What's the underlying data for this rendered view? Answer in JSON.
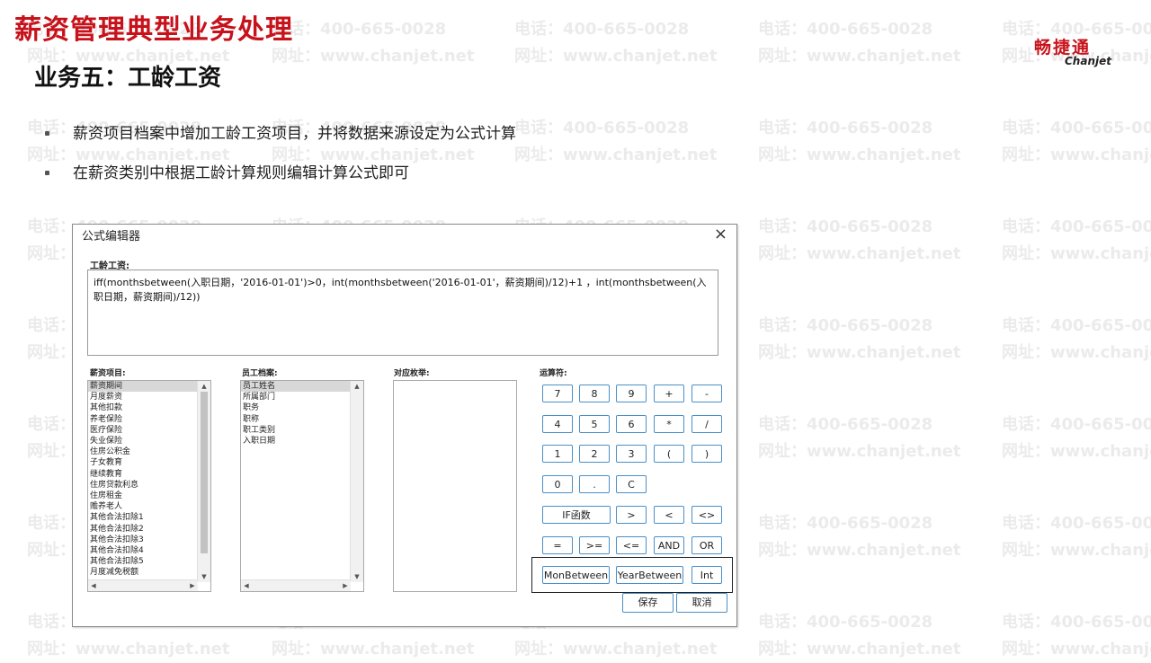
{
  "watermark": {
    "phone": "电话：400-665-0028",
    "site": "网址：www.chanjet.net"
  },
  "header": {
    "title": "薪资管理典型业务处理",
    "subtitle": "业务五：工龄工资"
  },
  "logo": {
    "cn": "畅捷通",
    "en": "Chanjet"
  },
  "bullets": [
    "薪资项目档案中增加工龄工资项目，并将数据来源设定为公式计算",
    "在薪资类别中根据工龄计算规则编辑计算公式即可"
  ],
  "dialog": {
    "title": "公式编辑器",
    "close_icon": "×",
    "formula_label": "工龄工资:",
    "formula_text": "iff(monthsbetween(入职日期，'2016-01-01')>0，int(monthsbetween('2016-01-01'，薪资期间)/12)+1 ，int(monthsbetween(入职日期，薪资期间)/12))",
    "salary_items": {
      "label": "薪资项目:",
      "items": [
        "薪资期间",
        "月度薪资",
        "其他扣款",
        "养老保险",
        "医疗保险",
        "失业保险",
        "住房公积金",
        "子女教育",
        "继续教育",
        "住房贷款利息",
        "住房租金",
        "赡养老人",
        "其他合法扣除1",
        "其他合法扣除2",
        "其他合法扣除3",
        "其他合法扣除4",
        "其他合法扣除5",
        "月度减免税额"
      ]
    },
    "employee_files": {
      "label": "员工档案:",
      "items": [
        "员工姓名",
        "所属部门",
        "职务",
        "职称",
        "职工类别",
        "入职日期"
      ]
    },
    "mapping": {
      "label": "对应枚举:"
    },
    "operators": {
      "label": "运算符:",
      "rows": [
        [
          "7",
          "8",
          "9",
          "+",
          "-"
        ],
        [
          "4",
          "5",
          "6",
          "*",
          "/"
        ],
        [
          "1",
          "2",
          "3",
          "(",
          ")"
        ],
        [
          "0",
          ".",
          "C"
        ],
        [
          "IF函数",
          ">",
          "<",
          "<>"
        ],
        [
          "=",
          ">=",
          "<=",
          "AND",
          "OR"
        ]
      ],
      "funcs": [
        "MonBetween",
        "YearBetween",
        "Int"
      ]
    },
    "save_label": "保存",
    "cancel_label": "取消"
  }
}
